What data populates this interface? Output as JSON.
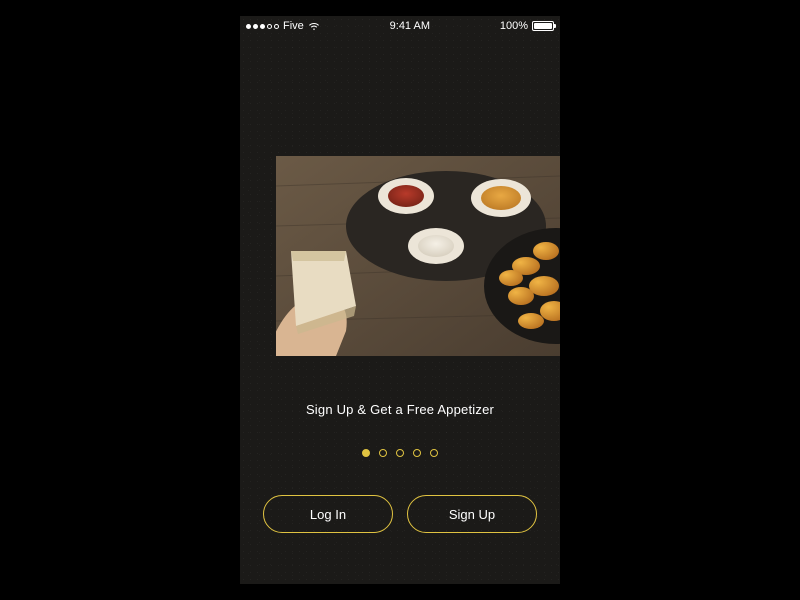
{
  "statusBar": {
    "carrier": "Five",
    "time": "9:41 AM",
    "batteryPercent": "100%"
  },
  "hero": {
    "tagline": "Sign Up & Get a Free Appetizer"
  },
  "pagination": {
    "count": 5,
    "activeIndex": 0
  },
  "buttons": {
    "login": "Log In",
    "signup": "Sign Up"
  },
  "colors": {
    "accent": "#e0c341"
  }
}
